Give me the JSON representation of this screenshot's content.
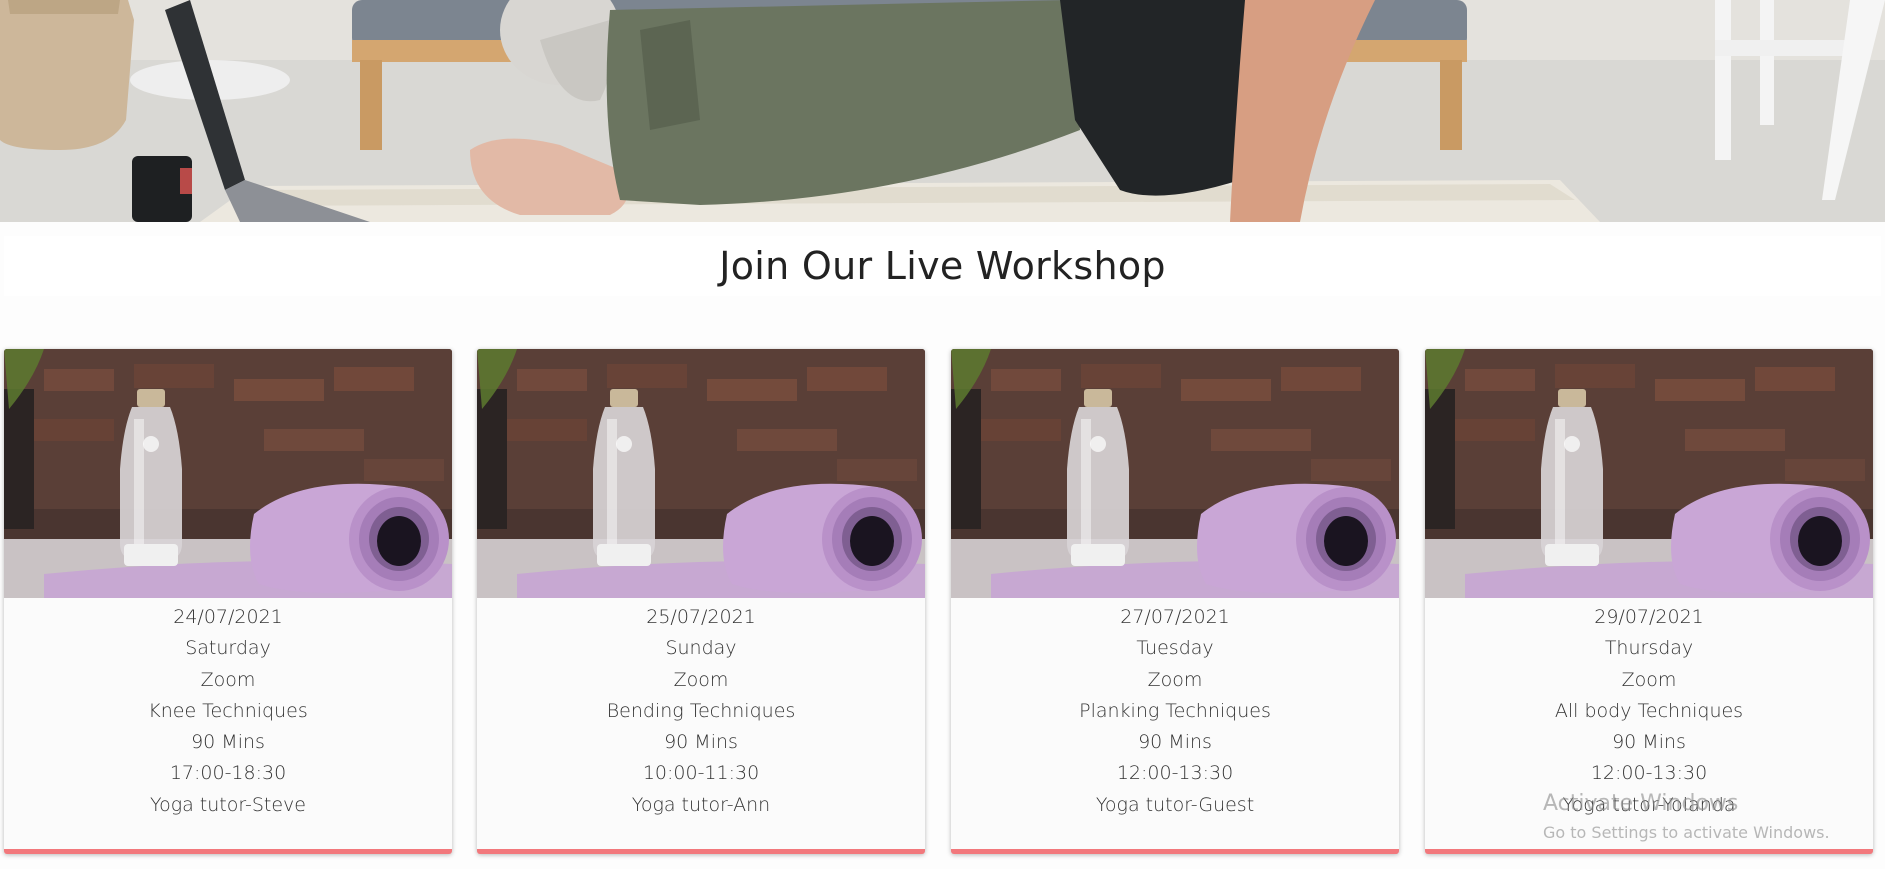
{
  "hero": {
    "image": "person-planking-laptop-photo"
  },
  "section": {
    "title": "Join Our Live Workshop"
  },
  "cards": [
    {
      "image": "yoga-mat-bottle-photo",
      "date": "24/07/2021",
      "day": "Saturday",
      "platform": "Zoom",
      "topic": "Knee Techniques",
      "duration": "90 Mins",
      "time": "17:00-18:30",
      "tutor": "Yoga tutor-Steve"
    },
    {
      "image": "yoga-mat-bottle-photo",
      "date": "25/07/2021",
      "day": "Sunday",
      "platform": "Zoom",
      "topic": "Bending Techniques",
      "duration": "90 Mins",
      "time": "10:00-11:30",
      "tutor": "Yoga tutor-Ann"
    },
    {
      "image": "yoga-mat-bottle-photo",
      "date": "27/07/2021",
      "day": "Tuesday",
      "platform": "Zoom",
      "topic": "Planking Techniques",
      "duration": "90 Mins",
      "time": "12:00-13:30",
      "tutor": "Yoga tutor-Guest"
    },
    {
      "image": "yoga-mat-bottle-photo",
      "date": "29/07/2021",
      "day": "Thursday",
      "platform": "Zoom",
      "topic": "All body Techniques",
      "duration": "90 Mins",
      "time": "12:00-13:30",
      "tutor": "Yoga tutor-Yolanda"
    }
  ],
  "watermark": {
    "title": "Activate Windows",
    "subtitle": "Go to Settings to activate Windows."
  },
  "colors": {
    "card_accent": "#f2787c",
    "heading_text": "#222222",
    "card_text": "#333333"
  }
}
